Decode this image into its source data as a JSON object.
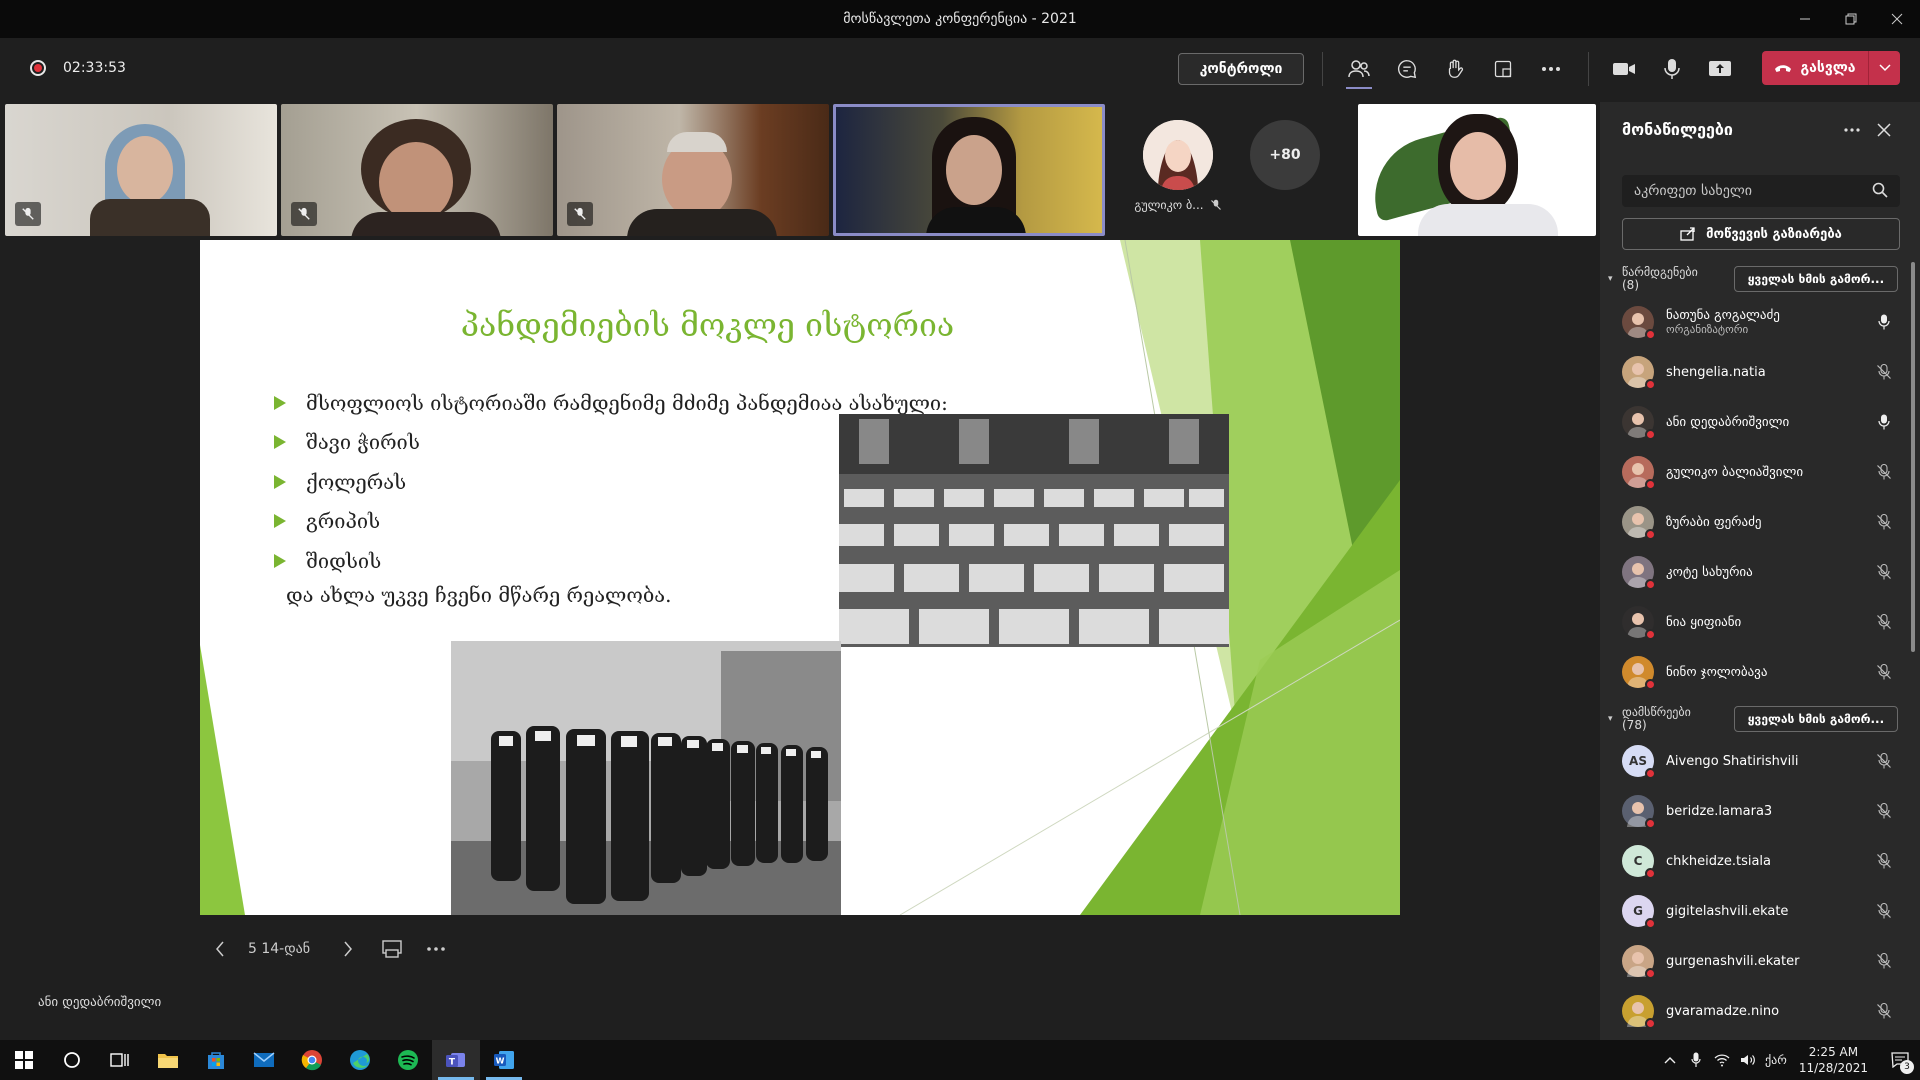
{
  "window": {
    "title": "მოსწავლეთა კონფერენცია - 2021"
  },
  "toolbar": {
    "timer": "02:33:53",
    "control_label": "კონტროლი",
    "leave_label": "გასვლა"
  },
  "video_strip": {
    "avatar_name": "გულიკო ბ...",
    "more_count": "+80"
  },
  "slide": {
    "title": "პანდემიების მოკლე ისტორია",
    "bullets": [
      "მსოფლიოს ისტორიაში რამდენიმე მძიმე პანდემიაა ასახული:",
      "შავი ჭირის",
      "ქოლერას",
      "გრიპის",
      "შიდსის"
    ],
    "closing": "და ახლა უკვე ჩვენი მწარე რეალობა.",
    "accent_color": "#7ab531"
  },
  "slide_nav": {
    "counter": "5 14-დან"
  },
  "presenter_label": "ანი დედაბრიშვილი",
  "panel": {
    "title": "მონაწილეები",
    "search_placeholder": "აკრიფეთ სახელი",
    "share_label": "მოწვევის გაზიარება",
    "presenters_header": "წარმდგენები",
    "presenters_count": "(8)",
    "attendees_header": "დამსწრეები",
    "attendees_count": "(78)",
    "mute_all_label": "ყველას ხმის გამორ...",
    "presenters": [
      {
        "name": "ნათუნა გოგალაძე",
        "role": "ორგანიზატორი",
        "mic": "on",
        "avatar": "photo"
      },
      {
        "name": "shengelia.natia",
        "role": "",
        "mic": "off",
        "avatar": "photo"
      },
      {
        "name": "ანი დედაბრიშვილი",
        "role": "",
        "mic": "on",
        "avatar": "photo"
      },
      {
        "name": "გულიკო ბალიაშვილი",
        "role": "",
        "mic": "off",
        "avatar": "photo"
      },
      {
        "name": "ზურაბი ფერაძე",
        "role": "",
        "mic": "off",
        "avatar": "photo"
      },
      {
        "name": "კოტე სახურია",
        "role": "",
        "mic": "off",
        "avatar": "photo"
      },
      {
        "name": "ნია ყიფიანი",
        "role": "",
        "mic": "off",
        "avatar": "photo"
      },
      {
        "name": "ნინო ჯოლობავა",
        "role": "",
        "mic": "off",
        "avatar": "photo"
      }
    ],
    "attendees": [
      {
        "name": "Aivengo Shatirishvili",
        "initials": "AS",
        "mic": "off",
        "color": "#d6dcf5"
      },
      {
        "name": "beridze.lamara3",
        "initials": "",
        "mic": "off",
        "color": "#5a6070"
      },
      {
        "name": "chkheidze.tsiala",
        "initials": "C",
        "mic": "off",
        "color": "#cfe8d8"
      },
      {
        "name": "gigitelashvili.ekate",
        "initials": "G",
        "mic": "off",
        "color": "#dcd6f0"
      },
      {
        "name": "gurgenashvili.ekater",
        "initials": "",
        "mic": "off",
        "color": "#c9a586"
      },
      {
        "name": "gvaramadze.nino",
        "initials": "",
        "mic": "off",
        "color": "#c8a030"
      }
    ]
  },
  "taskbar": {
    "time": "2:25 AM",
    "date": "11/28/2021",
    "language": "ქარ",
    "notifications": "3"
  }
}
